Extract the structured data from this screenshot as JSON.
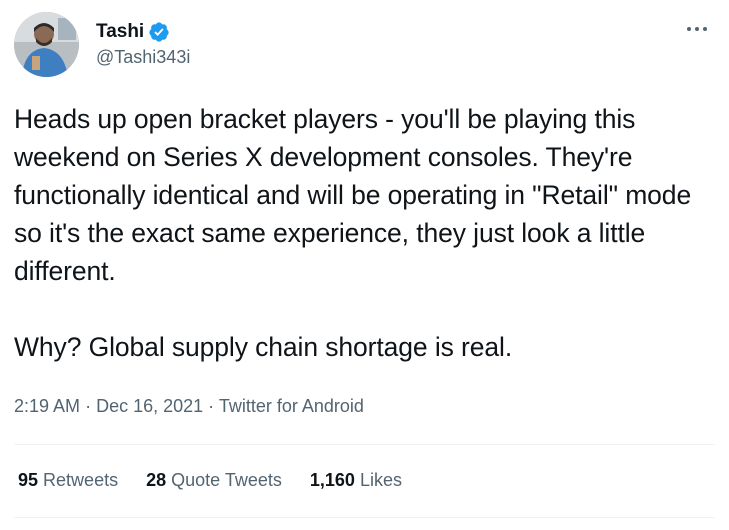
{
  "author": {
    "display_name": "Tashi",
    "handle": "@Tashi343i",
    "verified": true
  },
  "tweet": {
    "paragraph1": "Heads up open bracket players - you'll be playing this weekend on Series X development consoles. They're functionally identical and will be operating in \"Retail\" mode so it's the exact same experience, they just look a little different.",
    "paragraph2": "Why? Global supply chain shortage is real.",
    "time": "2:19 AM",
    "date": "Dec 16, 2021",
    "source": "Twitter for Android",
    "separator": "·"
  },
  "stats": {
    "retweets_count": "95",
    "retweets_label": "Retweets",
    "quote_count": "28",
    "quote_label": "Quote Tweets",
    "likes_count": "1,160",
    "likes_label": "Likes"
  },
  "icons": {
    "verified": "verified-badge-icon",
    "more": "more-options-icon"
  },
  "colors": {
    "text": "#0f1419",
    "secondary": "#536471",
    "verified_blue": "#1d9bf0",
    "divider": "#eff3f4"
  }
}
